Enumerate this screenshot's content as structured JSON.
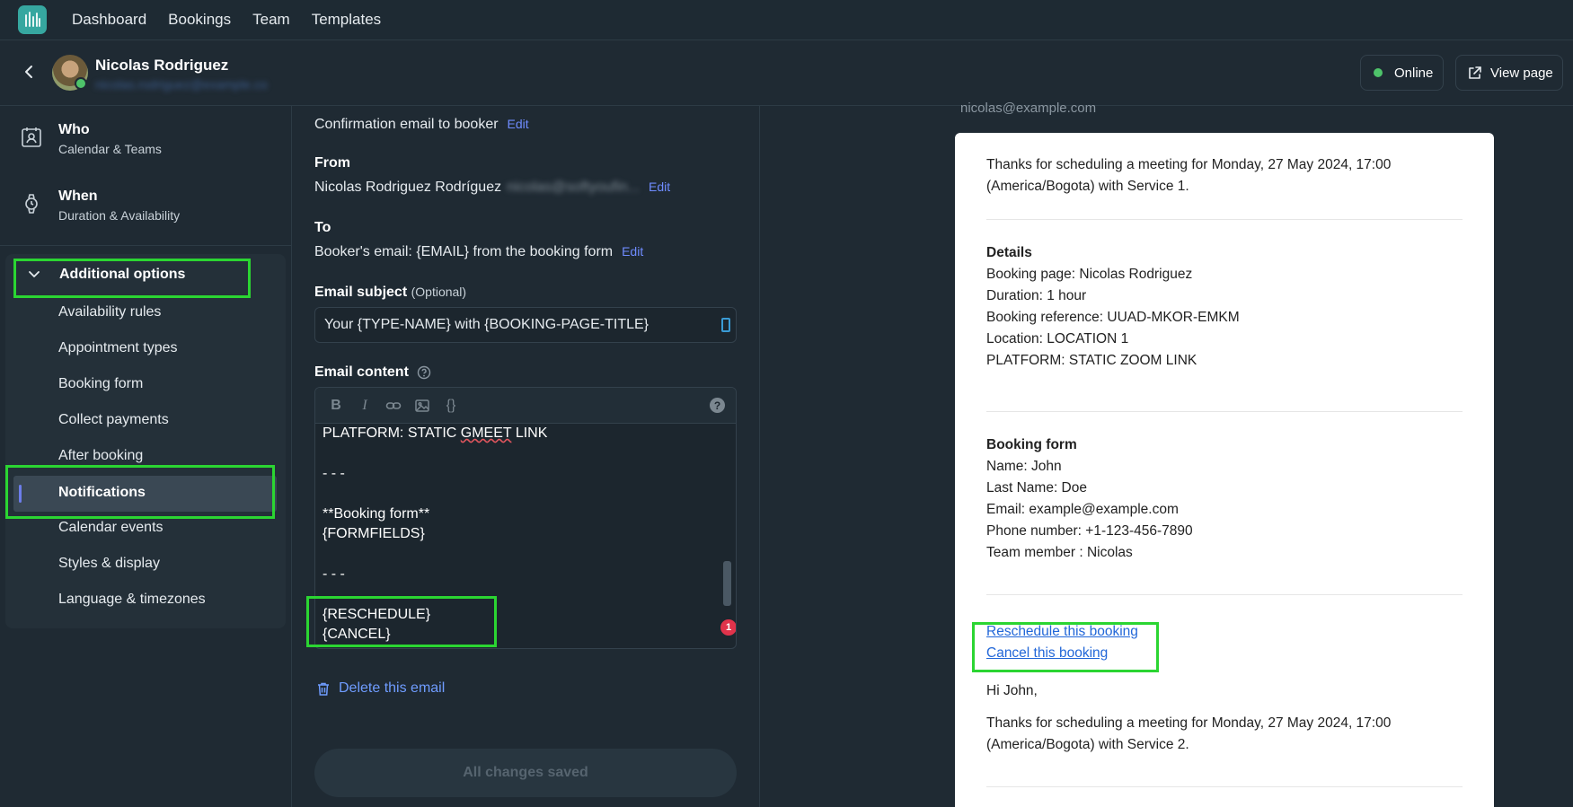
{
  "topnav": {
    "logo": "bar-chart-logo-icon",
    "links": [
      "Dashboard",
      "Bookings",
      "Team",
      "Templates"
    ]
  },
  "header": {
    "name": "Nicolas Rodriguez",
    "email": "nicolas.rodriguez@example.co",
    "status_label": "Online",
    "view_page_label": "View page"
  },
  "sidebar": {
    "who": {
      "title": "Who",
      "subtitle": "Calendar & Teams"
    },
    "when": {
      "title": "When",
      "subtitle": "Duration & Availability"
    },
    "additional": {
      "title": "Additional options",
      "items": [
        "Availability rules",
        "Appointment types",
        "Booking form",
        "Collect payments",
        "After booking",
        "Notifications",
        "Calendar events",
        "Styles & display",
        "Language & timezones"
      ],
      "active": "Notifications"
    }
  },
  "form": {
    "confirmation": "Confirmation email to booker",
    "edit": "Edit",
    "from_label": "From",
    "from_value": "Nicolas Rodriguez Rodríguez",
    "from_email": "nicolas@softyoufin...",
    "to_label": "To",
    "to_value": "Booker's email: {EMAIL} from the booking form",
    "subject_label": "Email subject",
    "subject_optional": "(Optional)",
    "subject_value": "Your {TYPE-NAME} with {BOOKING-PAGE-TITLE}",
    "content_label": "Email content",
    "editor_lines": [
      "PLATFORM: STATIC GMEET LINK",
      "",
      "- - -",
      "",
      "**Booking form**",
      "{FORMFIELDS}",
      "",
      "- - -",
      "",
      "{RESCHEDULE}",
      "{CANCEL}"
    ],
    "badge_count": "1",
    "delete_label": "Delete this email",
    "saved_label": "All changes saved"
  },
  "preview": {
    "cut_text": "nicolas@example.com",
    "intro": "Thanks for scheduling a meeting for Monday, 27 May 2024, 17:00 (America/Bogota) with Service 1.",
    "details_title": "Details",
    "details": [
      "Booking page: Nicolas Rodriguez",
      "Duration: 1 hour",
      "Booking reference: UUAD-MKOR-EMKM",
      "Location: LOCATION 1",
      "PLATFORM: STATIC ZOOM LINK"
    ],
    "form_title": "Booking form",
    "form_fields": [
      "Name: John",
      "Last Name: Doe",
      "Email: example@example.com",
      "Phone number: +1-123-456-7890",
      "Team member : Nicolas"
    ],
    "reschedule": "Reschedule this booking",
    "cancel": "Cancel this booking",
    "greeting": "Hi John,",
    "intro2": "Thanks for scheduling a meeting for Monday, 27 May 2024, 17:00 (America/Bogota) with Service 2."
  },
  "colors": {
    "highlight": "#2bd532",
    "accent_link": "#6f8cff",
    "online": "#4ec36a"
  }
}
